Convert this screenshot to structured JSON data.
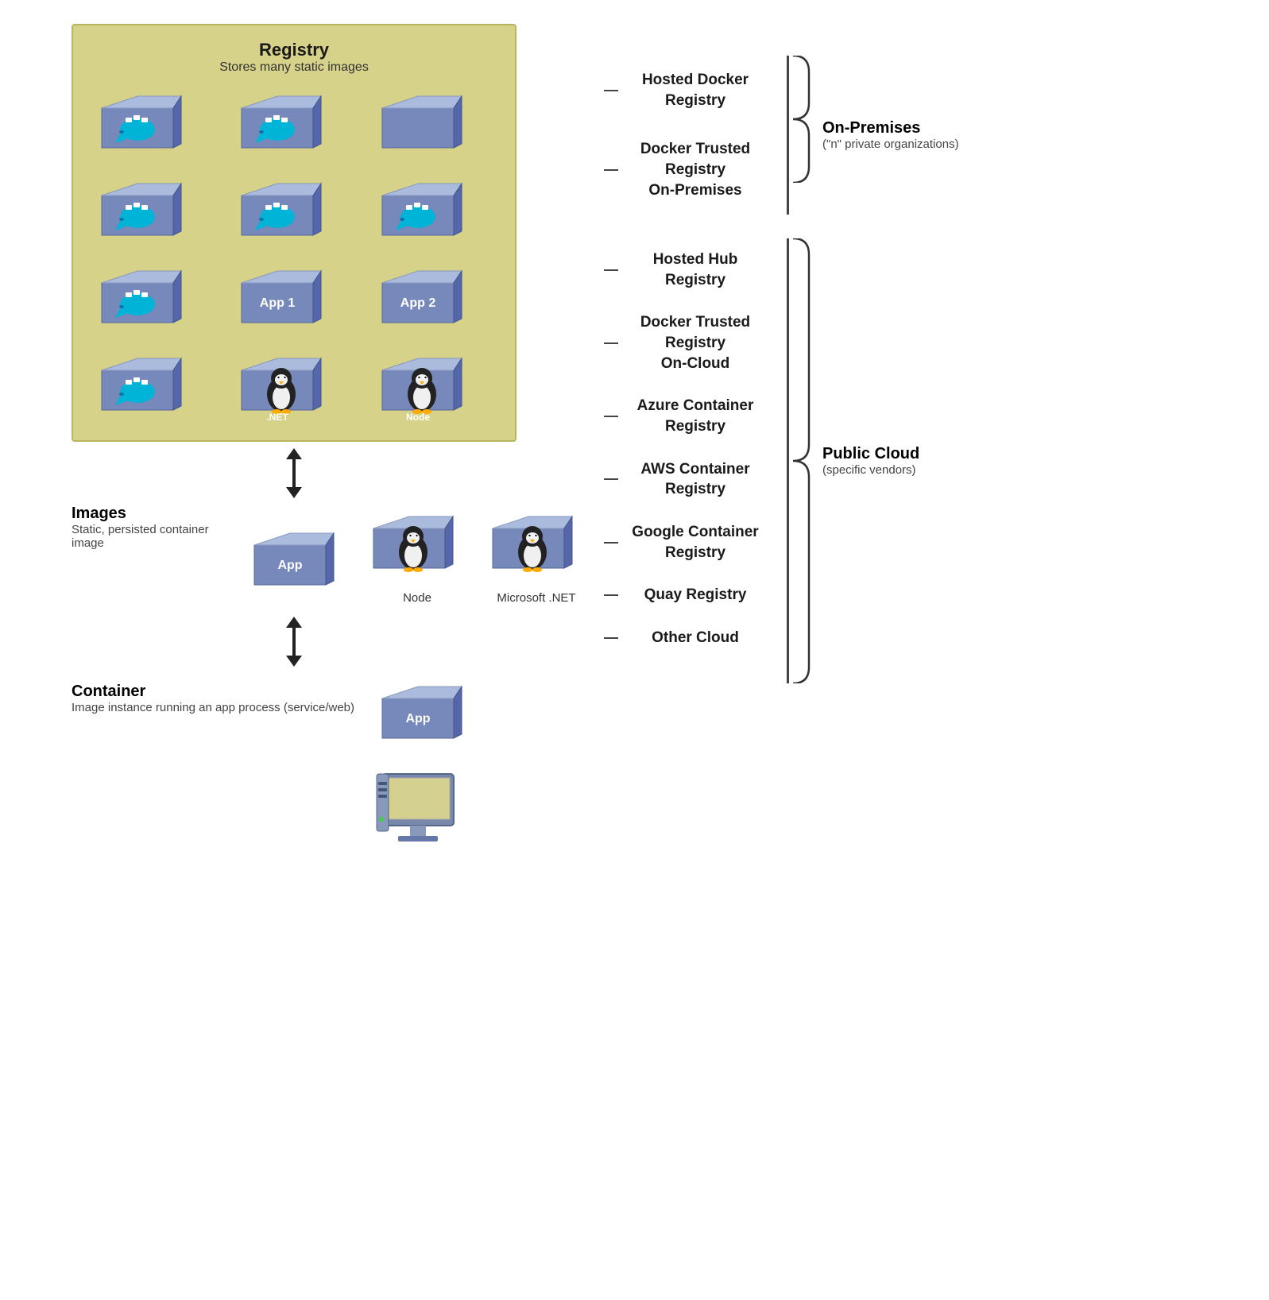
{
  "registry_box": {
    "title": "Registry",
    "subtitle": "Stores many static images"
  },
  "containers": [
    {
      "label": "",
      "icon": "docker"
    },
    {
      "label": "",
      "icon": "docker"
    },
    {
      "label": "",
      "icon": "none"
    },
    {
      "label": "",
      "icon": "docker"
    },
    {
      "label": "",
      "icon": "docker"
    },
    {
      "label": "",
      "icon": "docker"
    },
    {
      "label": "",
      "icon": "docker"
    },
    {
      "label": "App 1",
      "icon": "none"
    },
    {
      "label": "App 2",
      "icon": "none"
    },
    {
      "label": "",
      "icon": "docker"
    },
    {
      "label": ".NET",
      "icon": "penguin"
    },
    {
      "label": "Node",
      "icon": "penguin"
    }
  ],
  "images_section": {
    "title": "Images",
    "desc": "Static, persisted container image",
    "node_label": "Node",
    "net_label": "Microsoft .NET",
    "containers": [
      {
        "label": "App",
        "icon": "none"
      },
      {
        "label": "",
        "icon": "penguin"
      },
      {
        "label": "",
        "icon": "penguin"
      }
    ]
  },
  "container_section": {
    "title": "Container",
    "desc": "Image instance  running an app process (service/web)",
    "containers": [
      {
        "label": "App",
        "icon": "none"
      }
    ]
  },
  "registry_groups": [
    {
      "id": "on-premises",
      "group_title": "On-Premises",
      "group_sub": "(\"n\" private organizations)",
      "items": [
        "Hosted Docker\nRegistry",
        "Docker Trusted\nRegistry\nOn-Premises"
      ]
    },
    {
      "id": "public-cloud",
      "group_title": "Public Cloud",
      "group_sub": "(specific vendors)",
      "items": [
        "Hosted Hub\nRegistry",
        "Docker Trusted\nRegistry\nOn-Cloud",
        "Azure Container\nRegistry",
        "AWS Container\nRegistry",
        "Google Container\nRegistry",
        "Quay Registry",
        "Other Cloud"
      ]
    }
  ]
}
